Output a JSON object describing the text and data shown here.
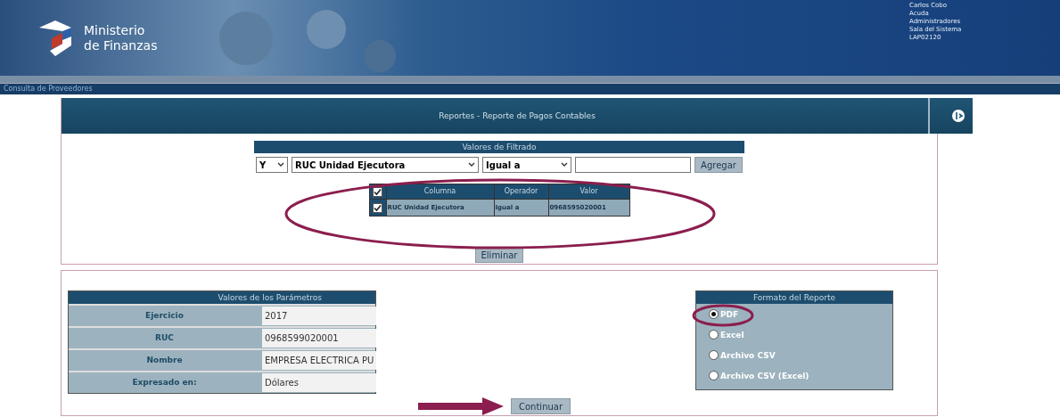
{
  "header": {
    "logo_text": [
      "Ministerio",
      "de Finanzas"
    ],
    "user_info": [
      "Carlos Cobo",
      "Acuda",
      "Administradores",
      "Sala del Sistema",
      "LAP02120"
    ]
  },
  "nav": {
    "breadcrumb": "Consulta de Proveedores"
  },
  "report": {
    "title": "Reportes - Reporte de Pagos Contables"
  },
  "filter": {
    "title": "Valores de Filtrado",
    "connector": "Y",
    "column": "RUC Unidad Ejecutora",
    "operator": "Igual a",
    "add_button": "Agregar",
    "table": {
      "all_checked": true,
      "columns": [
        "Columna",
        "Operador",
        "Valor"
      ],
      "rows": [
        {
          "checked": true,
          "cells": [
            "RUC Unidad Ejecutora",
            "Igual a",
            "0968595020001"
          ]
        }
      ]
    },
    "delete_button": "Eliminar"
  },
  "parameters": {
    "title": "Valores de los Parámetros",
    "rows": [
      {
        "label": "Ejercicio",
        "value": "2017"
      },
      {
        "label": "RUC",
        "value": "0968599020001"
      },
      {
        "label": "Nombre",
        "value": "EMPRESA ELECTRICA PU"
      },
      {
        "label": "Expresado en:",
        "value": "Dólares"
      }
    ]
  },
  "format": {
    "title": "Formato del Reporte",
    "options": [
      {
        "label": "PDF",
        "selected": true
      },
      {
        "label": "Excel",
        "selected": false
      },
      {
        "label": "Archivo CSV",
        "selected": false
      },
      {
        "label": "Archivo CSV (Excel)",
        "selected": false
      }
    ]
  },
  "continue_button": "Continuar"
}
